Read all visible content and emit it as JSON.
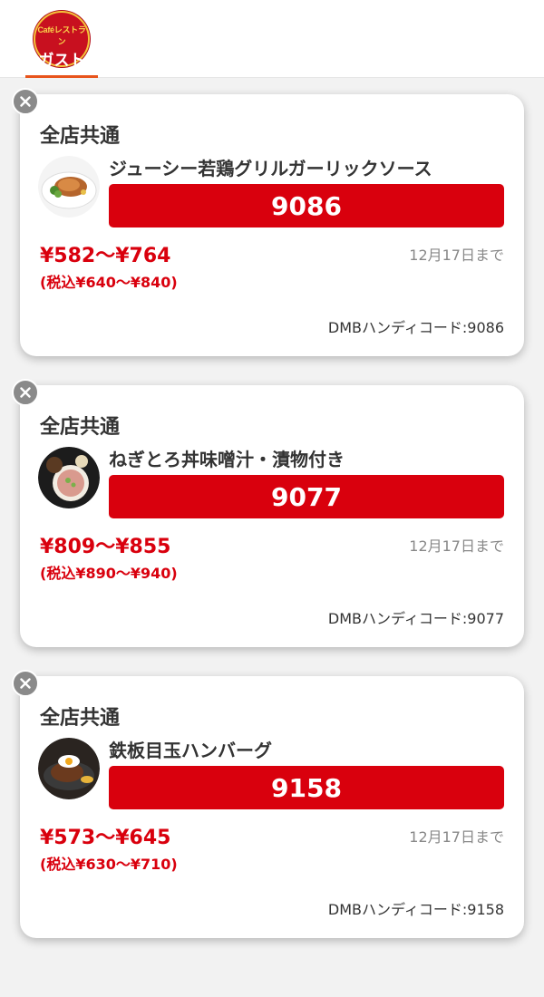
{
  "header": {
    "logo_top": "Caféレストラン",
    "logo_main": "ガスト"
  },
  "coupons": [
    {
      "scope": "全店共通",
      "name": "ジューシー若鶏グリルガーリックソース",
      "code": "9086",
      "price": "¥582〜¥764",
      "price_tax": "(税込¥640〜¥840)",
      "expiry": "12月17日まで",
      "handy_code": "DMBハンディコード:9086",
      "thumb_icon": "grilled-chicken-icon"
    },
    {
      "scope": "全店共通",
      "name": "ねぎとろ丼味噌汁・漬物付き",
      "code": "9077",
      "price": "¥809〜¥855",
      "price_tax": "(税込¥890〜¥940)",
      "expiry": "12月17日まで",
      "handy_code": "DMBハンディコード:9077",
      "thumb_icon": "negitoro-don-icon"
    },
    {
      "scope": "全店共通",
      "name": "鉄板目玉ハンバーグ",
      "code": "9158",
      "price": "¥573〜¥645",
      "price_tax": "(税込¥630〜¥710)",
      "expiry": "12月17日まで",
      "handy_code": "DMBハンディコード:9158",
      "thumb_icon": "hamburg-steak-icon"
    }
  ],
  "colors": {
    "accent_red": "#d9000d",
    "tab_underline": "#e8541c",
    "close_gray": "#8a8a8a"
  }
}
